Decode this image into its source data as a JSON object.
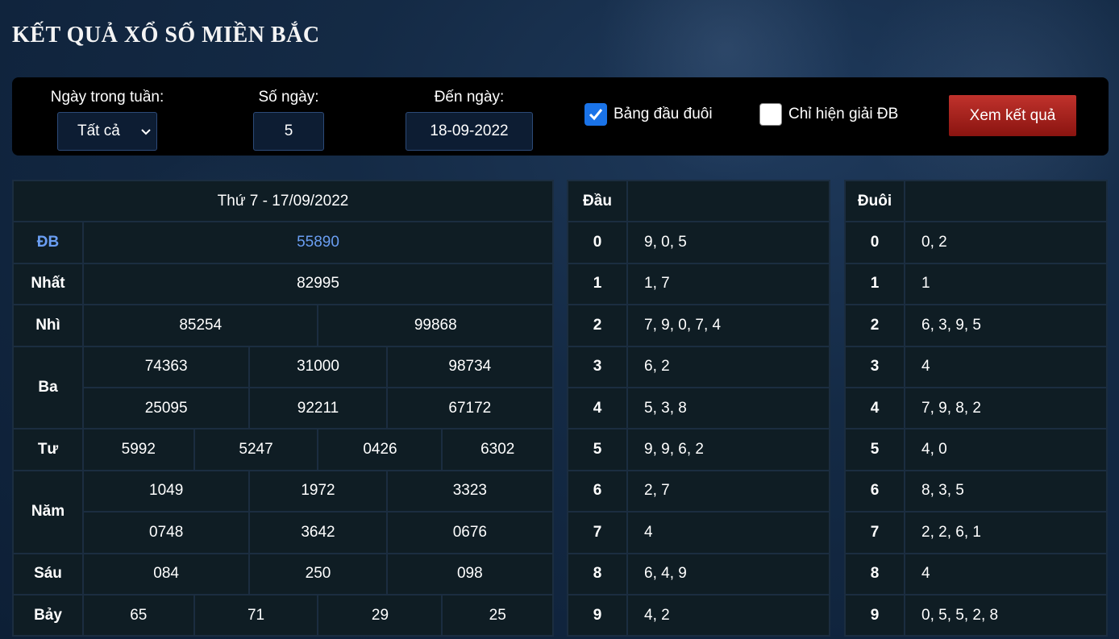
{
  "page": {
    "title": "KẾT QUẢ XỔ SỐ MIỀN BẮC"
  },
  "filters": {
    "weekday_label": "Ngày trong tuần:",
    "weekday_value": "Tất cả",
    "days_label": "Số ngày:",
    "days_value": "5",
    "todate_label": "Đến ngày:",
    "todate_value": "18-09-2022",
    "headtail_label": "Bảng đầu đuôi",
    "headtail_checked": true,
    "onlydb_label": "Chỉ hiện giải ĐB",
    "onlydb_checked": false,
    "submit_label": "Xem kết quả"
  },
  "results": {
    "date_header": "Thứ 7 - 17/09/2022",
    "db_label": "ĐB",
    "db": "55890",
    "nhat_label": "Nhất",
    "nhat": "82995",
    "nhi_label": "Nhì",
    "nhi": [
      "85254",
      "99868"
    ],
    "ba_label": "Ba",
    "ba": [
      "74363",
      "31000",
      "98734",
      "25095",
      "92211",
      "67172"
    ],
    "tu_label": "Tư",
    "tu": [
      "5992",
      "5247",
      "0426",
      "6302"
    ],
    "nam_label": "Năm",
    "nam": [
      "1049",
      "1972",
      "3323",
      "0748",
      "3642",
      "0676"
    ],
    "sau_label": "Sáu",
    "sau": [
      "084",
      "250",
      "098"
    ],
    "bay_label": "Bảy",
    "bay": [
      "65",
      "71",
      "29",
      "25"
    ]
  },
  "head_table": {
    "header": "Đầu",
    "rows": [
      {
        "k": "0",
        "v": "9, 0, 5"
      },
      {
        "k": "1",
        "v": "1, 7"
      },
      {
        "k": "2",
        "v": "7, 9, 0, 7, 4"
      },
      {
        "k": "3",
        "v": "6, 2"
      },
      {
        "k": "4",
        "v": "5, 3, 8"
      },
      {
        "k": "5",
        "v": "9, 9, 6, 2"
      },
      {
        "k": "6",
        "v": "2, 7"
      },
      {
        "k": "7",
        "v": "4"
      },
      {
        "k": "8",
        "v": "6, 4, 9"
      },
      {
        "k": "9",
        "v": "4, 2"
      }
    ]
  },
  "tail_table": {
    "header": "Đuôi",
    "rows": [
      {
        "k": "0",
        "v": "0, 2"
      },
      {
        "k": "1",
        "v": "1"
      },
      {
        "k": "2",
        "v": "6, 3, 9, 5"
      },
      {
        "k": "3",
        "v": "4"
      },
      {
        "k": "4",
        "v": "7, 9, 8, 2"
      },
      {
        "k": "5",
        "v": "4, 0"
      },
      {
        "k": "6",
        "v": "8, 3, 5"
      },
      {
        "k": "7",
        "v": "2, 2, 6, 1"
      },
      {
        "k": "8",
        "v": "4"
      },
      {
        "k": "9",
        "v": "0, 5, 5, 2, 8"
      }
    ]
  },
  "icons": {
    "checkmark": "check-icon",
    "select_caret": "chevron-down-icon"
  },
  "colors": {
    "db_text": "#6a9ef2",
    "checkbox_on": "#1a73e8",
    "button": "#a82420"
  }
}
